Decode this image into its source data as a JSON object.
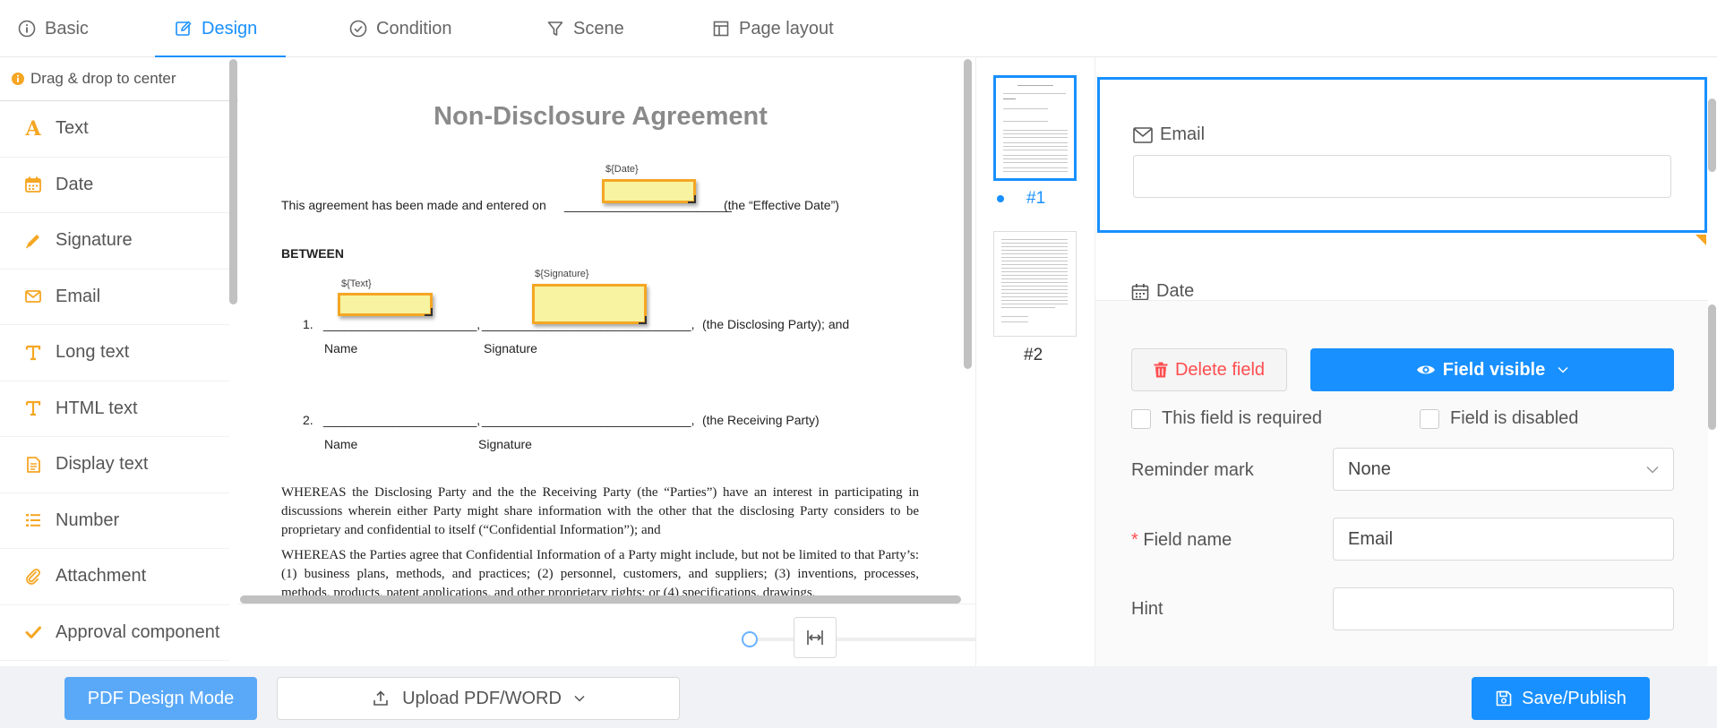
{
  "tabs": [
    {
      "label": "Basic",
      "icon": "info-icon"
    },
    {
      "label": "Design",
      "icon": "edit-icon",
      "active": true
    },
    {
      "label": "Condition",
      "icon": "check-circle-icon"
    },
    {
      "label": "Scene",
      "icon": "filter-icon"
    },
    {
      "label": "Page layout",
      "icon": "layout-icon"
    }
  ],
  "palette": {
    "hint": "Drag & drop to center",
    "items": [
      {
        "label": "Text",
        "icon": "text-icon"
      },
      {
        "label": "Date",
        "icon": "calendar-icon"
      },
      {
        "label": "Signature",
        "icon": "pen-icon"
      },
      {
        "label": "Email",
        "icon": "mail-icon"
      },
      {
        "label": "Long text",
        "icon": "long-text-icon"
      },
      {
        "label": "HTML text",
        "icon": "html-text-icon"
      },
      {
        "label": "Display text",
        "icon": "document-icon"
      },
      {
        "label": "Number",
        "icon": "list-number-icon"
      },
      {
        "label": "Attachment",
        "icon": "paperclip-icon"
      },
      {
        "label": "Approval component",
        "icon": "checkmark-icon"
      }
    ]
  },
  "document": {
    "title": "Non-Disclosure Agreement",
    "date_tag": "${Date}",
    "intro_before": "This agreement has been made and entered on",
    "intro_blank": "________________________",
    "intro_after": "(the “Effective Date”)",
    "between": "BETWEEN",
    "text_tag": "${Text}",
    "signature_tag": "${Signature}",
    "line1_num": "1.",
    "line1_blank_a": "______________________,",
    "line1_blank_b": "______________________________,",
    "line1_after": "(the Disclosing Party); and",
    "line2_num": "2.",
    "line2_blank_a": "______________________,",
    "line2_blank_b": "______________________________,",
    "line2_after": "(the Receiving Party)",
    "name_label": "Name",
    "signature_label": "Signature",
    "para1": "WHEREAS the Disclosing Party and the the Receiving Party (the “Parties”) have an interest in participating in discussions wherein either Party might share information with the other that the disclosing Party considers to be proprietary and confidential to itself (“Confidential Information”); and",
    "para2": "WHEREAS the Parties agree that Confidential Information of a Party might include, but not be limited to that Party’s: (1) business plans, methods, and practices; (2) personnel, customers, and suppliers; (3) inventions, processes, methods, products, patent applications, and other proprietary rights; or (4) specifications, drawings,"
  },
  "zoom": {
    "level": 0
  },
  "thumbnails": [
    {
      "label": "#1",
      "selected": true
    },
    {
      "label": "#2",
      "selected": false
    }
  ],
  "properties": {
    "preview_email_label": "Email",
    "preview_date_label": "Date",
    "delete_label": "Delete field",
    "visible_label": "Field visible",
    "required_label": "This field is required",
    "disabled_label": "Field is disabled",
    "reminder_label": "Reminder mark",
    "reminder_value": "None",
    "field_name_label": "Field name",
    "field_name_required_mark": "*",
    "field_name_value": "Email",
    "hint_label": "Hint",
    "hint_value": ""
  },
  "bottom": {
    "mode_label": "PDF Design Mode",
    "upload_label": "Upload PDF/WORD",
    "save_label": "Save/Publish"
  },
  "colors": {
    "accent": "#1890ff",
    "field_border": "#f5a623",
    "field_fill": "#f7f3a0",
    "danger": "#ff4d4f"
  }
}
